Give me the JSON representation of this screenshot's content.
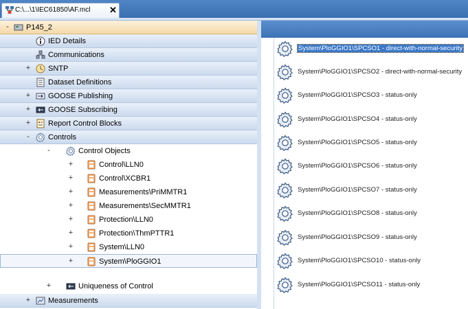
{
  "tab": {
    "title": "C:\\...\\1\\IEC61850\\AF.mcl",
    "close": "✕"
  },
  "tree": {
    "root": {
      "expander": "-",
      "label": "P145_2"
    },
    "ied_details": "IED Details",
    "communications": "Communications",
    "sntp": {
      "expander": "+",
      "label": "SNTP"
    },
    "dataset_definitions": "Dataset Definitions",
    "goose_publishing": {
      "expander": "+",
      "label": "GOOSE Publishing"
    },
    "goose_subscribing": {
      "expander": "+",
      "label": "GOOSE Subscribing"
    },
    "report_control_blocks": {
      "expander": "+",
      "label": "Report Control Blocks"
    },
    "controls": {
      "expander": "-",
      "label": "Controls"
    },
    "control_objects": {
      "expander": "-",
      "label": "Control Objects"
    },
    "control_object_items": [
      {
        "expander": "+",
        "label": "Control\\LLN0"
      },
      {
        "expander": "+",
        "label": "Control\\XCBR1"
      },
      {
        "expander": "+",
        "label": "Measurements\\PriMMTR1"
      },
      {
        "expander": "+",
        "label": "Measurements\\SecMMTR1"
      },
      {
        "expander": "+",
        "label": "Protection\\LLN0"
      },
      {
        "expander": "+",
        "label": "Protection\\ThmPTTR1"
      },
      {
        "expander": "+",
        "label": "System\\LLN0"
      },
      {
        "expander": "+",
        "label": "System\\PloGGIO1"
      }
    ],
    "uniqueness_of_control": {
      "expander": "+",
      "label": "Uniqueness of Control"
    },
    "measurements": {
      "expander": "+",
      "label": "Measurements"
    }
  },
  "list": {
    "items": [
      "System\\PloGGIO1\\SPCSO1 - direct-with-normal-security",
      "System\\PloGGIO1\\SPCSO2 - direct-with-normal-security",
      "System\\PloGGIO1\\SPCSO3 - status-only",
      "System\\PloGGIO1\\SPCSO4 - status-only",
      "System\\PloGGIO1\\SPCSO5 - status-only",
      "System\\PloGGIO1\\SPCSO6 - status-only",
      "System\\PloGGIO1\\SPCSO7 - status-only",
      "System\\PloGGIO1\\SPCSO8 - status-only",
      "System\\PloGGIO1\\SPCSO9 - status-only",
      "System\\PloGGIO1\\SPCSO10 - status-only",
      "System\\PloGGIO1\\SPCSO11 - status-only"
    ]
  }
}
